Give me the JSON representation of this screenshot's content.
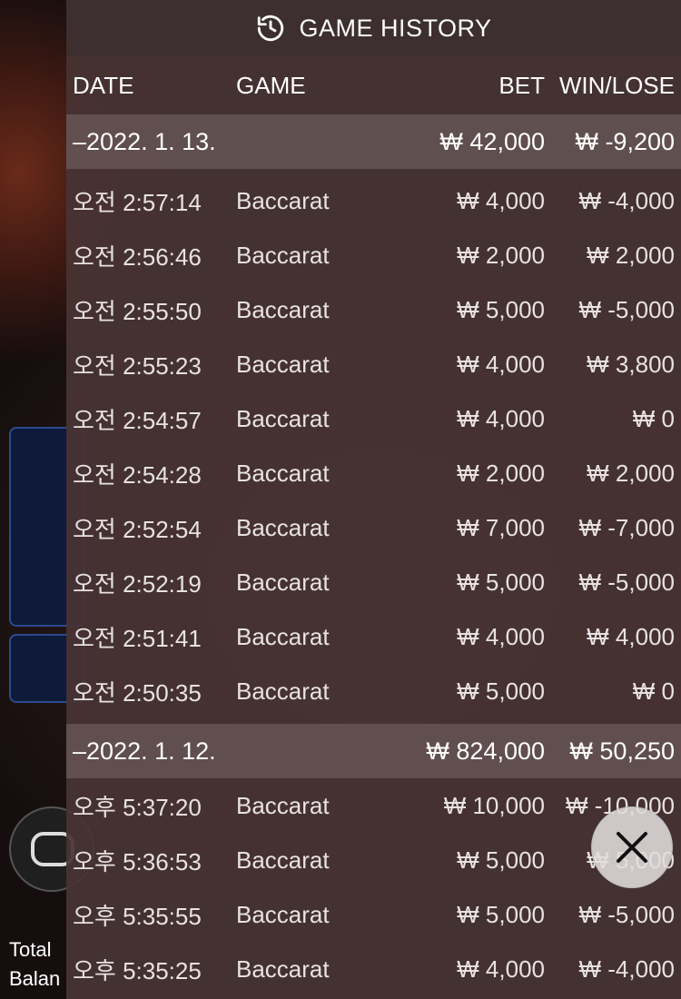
{
  "header": {
    "title": "GAME HISTORY",
    "icon": "history-icon"
  },
  "columns": {
    "date": "DATE",
    "game": "GAME",
    "bet": "BET",
    "win": "WIN/LOSE"
  },
  "days": [
    {
      "date": "–2022. 1. 13.",
      "total_bet": "₩ 42,000",
      "total_win": "₩ -9,200",
      "rows": [
        {
          "time": "오전 2:57:14",
          "game": "Baccarat",
          "bet": "₩ 4,000",
          "win": "₩ -4,000"
        },
        {
          "time": "오전 2:56:46",
          "game": "Baccarat",
          "bet": "₩ 2,000",
          "win": "₩ 2,000"
        },
        {
          "time": "오전 2:55:50",
          "game": "Baccarat",
          "bet": "₩ 5,000",
          "win": "₩ -5,000"
        },
        {
          "time": "오전 2:55:23",
          "game": "Baccarat",
          "bet": "₩ 4,000",
          "win": "₩ 3,800"
        },
        {
          "time": "오전 2:54:57",
          "game": "Baccarat",
          "bet": "₩ 4,000",
          "win": "₩ 0"
        },
        {
          "time": "오전 2:54:28",
          "game": "Baccarat",
          "bet": "₩ 2,000",
          "win": "₩ 2,000"
        },
        {
          "time": "오전 2:52:54",
          "game": "Baccarat",
          "bet": "₩ 7,000",
          "win": "₩ -7,000"
        },
        {
          "time": "오전 2:52:19",
          "game": "Baccarat",
          "bet": "₩ 5,000",
          "win": "₩ -5,000"
        },
        {
          "time": "오전 2:51:41",
          "game": "Baccarat",
          "bet": "₩ 4,000",
          "win": "₩ 4,000"
        },
        {
          "time": "오전 2:50:35",
          "game": "Baccarat",
          "bet": "₩ 5,000",
          "win": "₩ 0"
        }
      ]
    },
    {
      "date": "–2022. 1. 12.",
      "total_bet": "₩ 824,000",
      "total_win": "₩ 50,250",
      "rows": [
        {
          "time": "오후 5:37:20",
          "game": "Baccarat",
          "bet": "₩ 10,000",
          "win": "₩ -10,000"
        },
        {
          "time": "오후 5:36:53",
          "game": "Baccarat",
          "bet": "₩ 5,000",
          "win": "₩ 5,000"
        },
        {
          "time": "오후 5:35:55",
          "game": "Baccarat",
          "bet": "₩ 5,000",
          "win": "₩ -5,000"
        },
        {
          "time": "오후 5:35:25",
          "game": "Baccarat",
          "bet": "₩ 4,000",
          "win": "₩ -4,000"
        }
      ]
    }
  ],
  "background": {
    "total_label": "Total",
    "balance_label": "Balan"
  },
  "close": {
    "icon": "close-icon"
  }
}
